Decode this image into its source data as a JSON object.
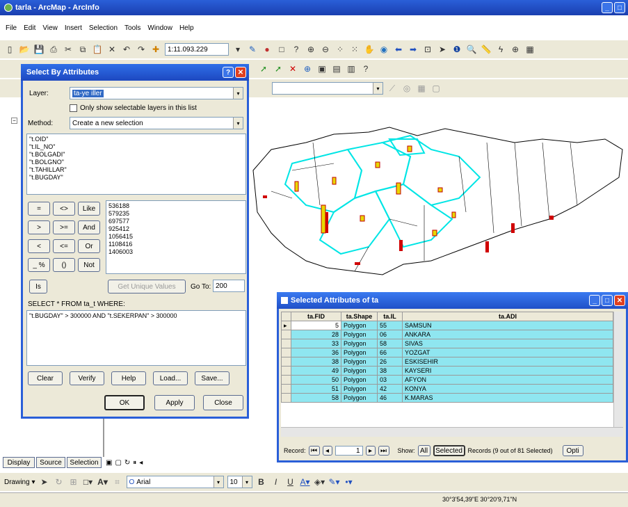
{
  "window": {
    "title": "tarla - ArcMap - ArcInfo"
  },
  "menu": [
    "File",
    "Edit",
    "View",
    "Insert",
    "Selection",
    "Tools",
    "Window",
    "Help"
  ],
  "toolbar": {
    "scale": "1:11.093.229"
  },
  "toc": {
    "tabs": [
      "Display",
      "Source",
      "Selection"
    ]
  },
  "drawing": {
    "label": "Drawing",
    "font": "Arial",
    "size": "10",
    "bold": "B",
    "italic": "I",
    "underline": "U",
    "text_tool": "A"
  },
  "status": {
    "coords": "30°3'54,39\"E 30°20'9,71\"N"
  },
  "dialog": {
    "title": "Select By Attributes",
    "layer_label": "Layer:",
    "layer_value": "ta-ye iller",
    "only_selectable": "Only show selectable layers in this list",
    "method_label": "Method:",
    "method_value": "Create a new selection",
    "fields": [
      "\"t.OID\"",
      "\"t.IL_NO\"",
      "\"t.BOLGADI\"",
      "\"t.BOLGNO\"",
      "\"t.TAHILLAR\"",
      "\"t.BUGDAY\""
    ],
    "operators": [
      "=",
      "<>",
      "Like",
      ">",
      ">=",
      "And",
      "<",
      "<=",
      "Or",
      "_ %",
      "()",
      "Not",
      "Is"
    ],
    "values": [
      "536188",
      "579235",
      "697577",
      "925412",
      "1056415",
      "1108416",
      "1406003"
    ],
    "get_unique": "Get Unique Values",
    "goto_label": "Go To:",
    "goto_value": "200",
    "query_label": "SELECT * FROM ta_t WHERE:",
    "query": "\"t.BUGDAY\" > 300000 AND \"t.SEKERPAN\" > 300000",
    "buttons": [
      "Clear",
      "Verify",
      "Help",
      "Load...",
      "Save..."
    ],
    "ok": "OK",
    "apply": "Apply",
    "close": "Close"
  },
  "attributes": {
    "title": "Selected Attributes of ta",
    "columns": [
      "ta.FID",
      "ta.Shape",
      "ta.IL",
      "ta.ADI"
    ],
    "rows": [
      [
        "5",
        "Polygon",
        "55",
        "SAMSUN"
      ],
      [
        "28",
        "Polygon",
        "06",
        "ANKARA"
      ],
      [
        "33",
        "Polygon",
        "58",
        "SIVAS"
      ],
      [
        "36",
        "Polygon",
        "66",
        "YOZGAT"
      ],
      [
        "38",
        "Polygon",
        "26",
        "ESKISEHIR"
      ],
      [
        "49",
        "Polygon",
        "38",
        "KAYSERI"
      ],
      [
        "50",
        "Polygon",
        "03",
        "AFYON"
      ],
      [
        "51",
        "Polygon",
        "42",
        "KONYA"
      ],
      [
        "58",
        "Polygon",
        "46",
        "K.MARAS"
      ]
    ],
    "record_label": "Record:",
    "record_value": "1",
    "show_label": "Show:",
    "all": "All",
    "selected": "Selected",
    "records_text": "Records (9 out of 81 Selected)",
    "options": "Opti"
  },
  "colors": {
    "title_blue": "#2a5fd8",
    "selection_cyan": "#8fe6f0",
    "outline_cyan": "#00e5e5"
  }
}
